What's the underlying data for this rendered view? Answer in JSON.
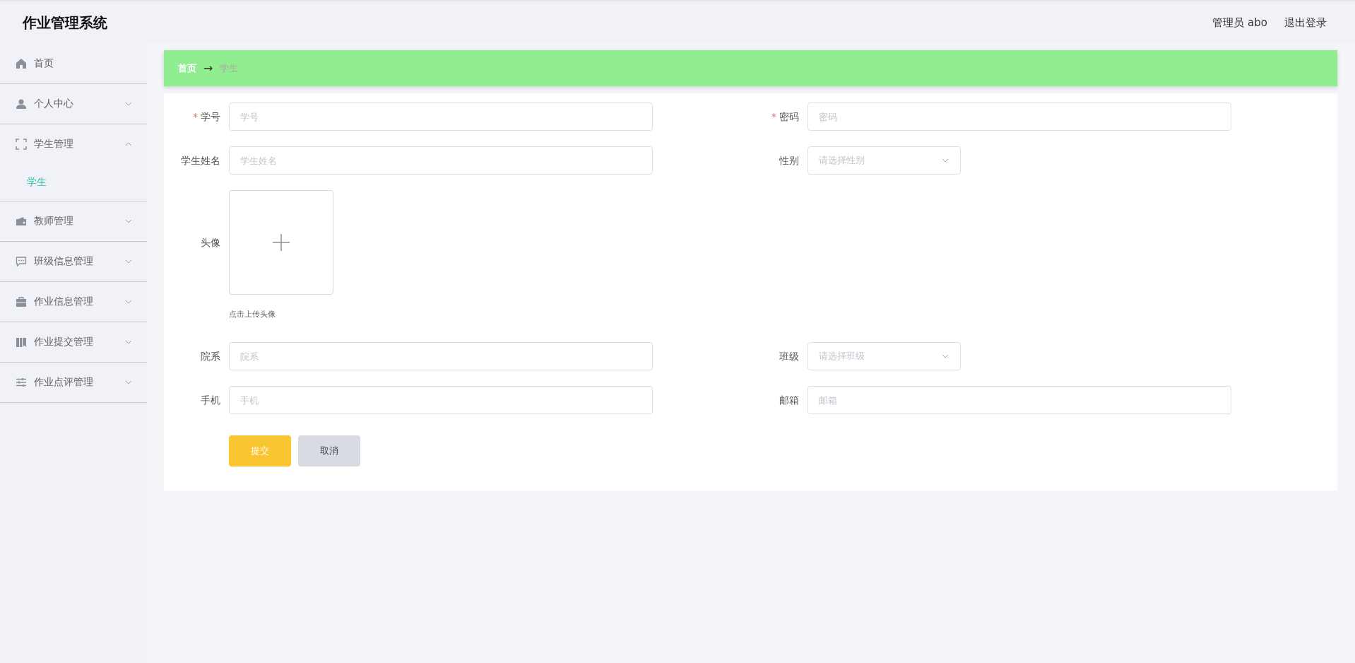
{
  "header": {
    "title": "作业管理系统",
    "user": "管理员 abo",
    "logout": "退出登录"
  },
  "sidebar": {
    "items": [
      {
        "label": "首页"
      },
      {
        "label": "个人中心",
        "expanded": false
      },
      {
        "label": "学生管理",
        "expanded": true,
        "children": [
          {
            "label": "学生",
            "selected": true
          }
        ]
      },
      {
        "label": "教师管理",
        "expanded": false
      },
      {
        "label": "班级信息管理",
        "expanded": false
      },
      {
        "label": "作业信息管理",
        "expanded": false
      },
      {
        "label": "作业提交管理",
        "expanded": false
      },
      {
        "label": "作业点评管理",
        "expanded": false
      }
    ]
  },
  "breadcrumb": {
    "items": [
      "首页",
      "学生"
    ],
    "separator": "→"
  },
  "form": {
    "fields": [
      {
        "label": "学号",
        "kind": "input",
        "required": true,
        "placeholder": "学号"
      },
      {
        "label": "密码",
        "kind": "input",
        "required": true,
        "placeholder": "密码"
      },
      {
        "label": "学生姓名",
        "kind": "input",
        "required": false,
        "placeholder": "学生姓名"
      },
      {
        "label": "性别",
        "kind": "select",
        "required": false,
        "placeholder": "请选择性别"
      },
      {
        "label": "头像",
        "kind": "upload",
        "required": false,
        "hint": "点击上传头像"
      },
      {
        "label": "院系",
        "kind": "input",
        "required": false,
        "placeholder": "院系"
      },
      {
        "label": "班级",
        "kind": "select",
        "required": false,
        "placeholder": "请选择班级"
      },
      {
        "label": "手机",
        "kind": "input",
        "required": false,
        "placeholder": "手机"
      },
      {
        "label": "邮箱",
        "kind": "input",
        "required": false,
        "placeholder": "邮箱"
      }
    ],
    "required_mark": "*",
    "buttons": [
      {
        "label": "提交",
        "kind": "primary"
      },
      {
        "label": "取消",
        "kind": "default"
      }
    ]
  }
}
